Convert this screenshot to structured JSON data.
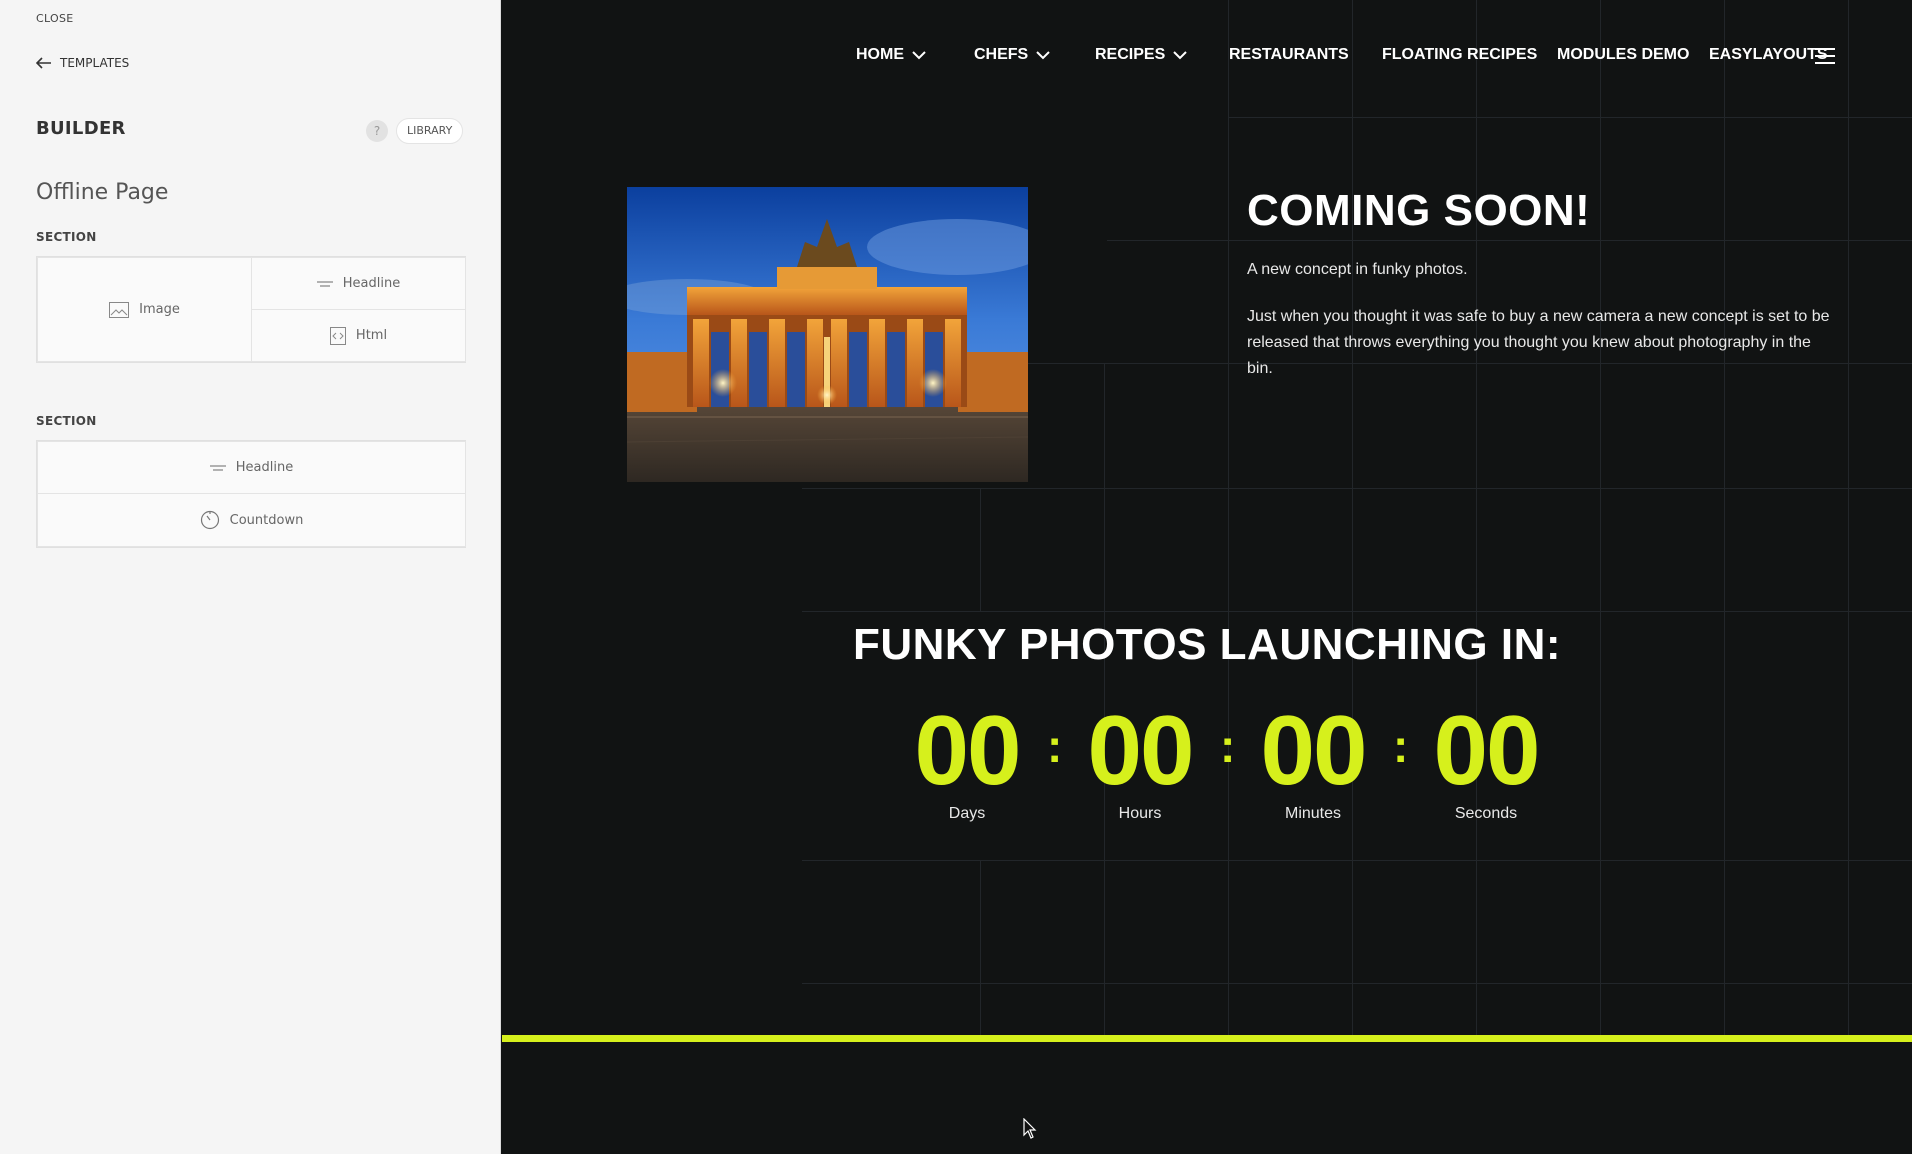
{
  "sidebar": {
    "close_label": "CLOSE",
    "templates_label": "TEMPLATES",
    "builder_title": "BUILDER",
    "help_label": "?",
    "library_label": "LIBRARY",
    "page_name": "Offline Page",
    "sections": [
      {
        "label": "SECTION",
        "modules": [
          {
            "label": "Image",
            "icon": "image-icon"
          },
          {
            "label": "Headline",
            "icon": "headline-icon"
          },
          {
            "label": "Html",
            "icon": "html-icon"
          }
        ]
      },
      {
        "label": "SECTION",
        "modules": [
          {
            "label": "Headline",
            "icon": "headline-icon"
          },
          {
            "label": "Countdown",
            "icon": "countdown-icon"
          }
        ]
      }
    ]
  },
  "preview": {
    "nav": [
      {
        "label": "HOME",
        "has_dropdown": true
      },
      {
        "label": "CHEFS",
        "has_dropdown": true
      },
      {
        "label": "RECIPES",
        "has_dropdown": true
      },
      {
        "label": "RESTAURANTS",
        "has_dropdown": false
      },
      {
        "label": "FLOATING RECIPES",
        "has_dropdown": false
      },
      {
        "label": "MODULES DEMO",
        "has_dropdown": false
      },
      {
        "label": "EASYLAYOUTS",
        "has_dropdown": false
      }
    ],
    "hero": {
      "title": "COMING SOON!",
      "subtitle": "A new concept in funky photos.",
      "body": "Just when you thought it was safe to buy a new camera a new concept is set to be released that throws everything you thought you knew about photography in the bin."
    },
    "countdown": {
      "title": "FUNKY PHOTOS LAUNCHING IN:",
      "units": [
        {
          "value": "00",
          "label": "Days"
        },
        {
          "value": "00",
          "label": "Hours"
        },
        {
          "value": "00",
          "label": "Minutes"
        },
        {
          "value": "00",
          "label": "Seconds"
        }
      ],
      "separator": ":"
    }
  },
  "colors": {
    "accent": "#d6f01c",
    "background": "#111313",
    "sidebar_bg": "#f5f5f5"
  }
}
